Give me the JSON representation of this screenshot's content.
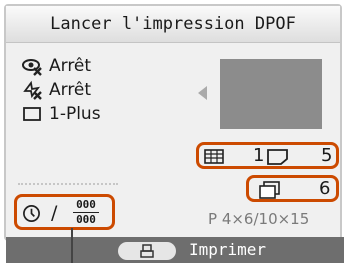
{
  "title": "Lancer l'impression DPOF",
  "settings": {
    "red_eye": "Arrêt",
    "image_optimize": "Arrêt",
    "layout": "1-Plus"
  },
  "dpof": {
    "index_count": "1",
    "print_count": "5",
    "sheets_count": "6",
    "date_separator": "/",
    "date_icon_text": "000"
  },
  "paper": "P 4×6/10×15",
  "footer": {
    "action_label": "Imprimer"
  },
  "colors": {
    "highlight": "#cc4a00",
    "footer_bg": "#6e6e6e",
    "preview": "#8c8c8c"
  },
  "icons": [
    "red-eye-icon",
    "image-optimize-icon",
    "layout-icon",
    "index-print-icon",
    "print-icon",
    "sheets-icon",
    "date-icon",
    "file-number-icon",
    "print-button-icon"
  ]
}
